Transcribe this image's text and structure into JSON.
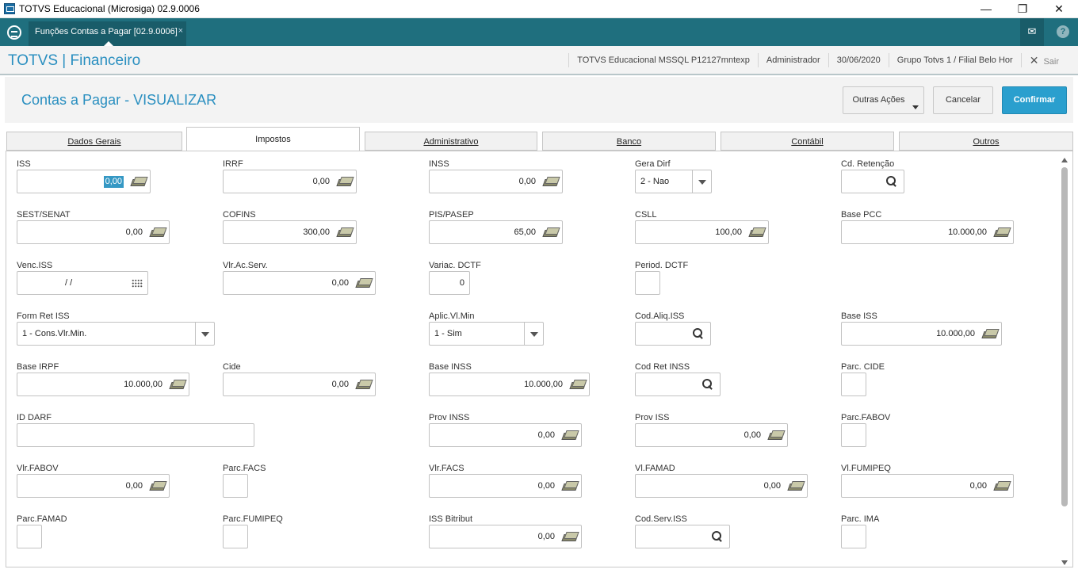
{
  "window": {
    "title": "TOTVS Educacional (Microsiga) 02.9.0006",
    "minimize": "—",
    "maximize": "❐",
    "close": "✕"
  },
  "appbar": {
    "tab_label": "Funções Contas a Pagar [02.9.0006]",
    "tab_close": "×",
    "mail_icon": "✉",
    "help_icon": "?"
  },
  "module": {
    "title": "TOTVS | Financeiro",
    "environment": "TOTVS Educacional MSSQL P12127mntexp",
    "user": "Administrador",
    "date": "30/06/2020",
    "branch": "Grupo Totvs 1 / Filial Belo Hor",
    "exit_icon": "✕",
    "exit_label": "Sair"
  },
  "page": {
    "title": "Contas a Pagar - VISUALIZAR",
    "buttons": {
      "more": "Outras Ações",
      "cancel": "Cancelar",
      "confirm": "Confirmar"
    }
  },
  "tabs": [
    {
      "label": "Dados Gerais"
    },
    {
      "label": "Impostos"
    },
    {
      "label": "Administrativo"
    },
    {
      "label": "Banco"
    },
    {
      "label": "Contábil"
    },
    {
      "label": "Outros"
    }
  ],
  "fields": {
    "iss": {
      "label": "ISS",
      "value": "0,00"
    },
    "irrf": {
      "label": "IRRF",
      "value": "0,00"
    },
    "inss": {
      "label": "INSS",
      "value": "0,00"
    },
    "gera_dirf": {
      "label": "Gera Dirf",
      "value": "2 - Nao"
    },
    "cd_retencao": {
      "label": "Cd. Retenção",
      "value": ""
    },
    "sest_senat": {
      "label": "SEST/SENAT",
      "value": "0,00"
    },
    "cofins": {
      "label": "COFINS",
      "value": "300,00"
    },
    "pis_pasep": {
      "label": "PIS/PASEP",
      "value": "65,00"
    },
    "csll": {
      "label": "CSLL",
      "value": "100,00"
    },
    "base_pcc": {
      "label": "Base PCC",
      "value": "10.000,00"
    },
    "venc_iss": {
      "label": "Venc.ISS",
      "value": "/  /"
    },
    "vlr_ac_serv": {
      "label": "Vlr.Ac.Serv.",
      "value": "0,00"
    },
    "variac_dctf": {
      "label": "Variac. DCTF",
      "value": "0"
    },
    "period_dctf": {
      "label": "Period. DCTF",
      "value": ""
    },
    "form_ret_iss": {
      "label": "Form Ret ISS",
      "value": "1 - Cons.Vlr.Min."
    },
    "aplic_vl_min": {
      "label": "Aplic.Vl.Min",
      "value": "1 - Sim"
    },
    "cod_aliq_iss": {
      "label": "Cod.Aliq.ISS",
      "value": ""
    },
    "base_iss": {
      "label": "Base ISS",
      "value": "10.000,00"
    },
    "base_irpf": {
      "label": "Base IRPF",
      "value": "10.000,00"
    },
    "cide": {
      "label": "Cide",
      "value": "0,00"
    },
    "base_inss": {
      "label": "Base INSS",
      "value": "10.000,00"
    },
    "cod_ret_inss": {
      "label": "Cod Ret INSS",
      "value": ""
    },
    "parc_cide": {
      "label": "Parc. CIDE",
      "value": ""
    },
    "id_darf": {
      "label": "ID DARF",
      "value": ""
    },
    "prov_inss": {
      "label": "Prov INSS",
      "value": "0,00"
    },
    "prov_iss": {
      "label": "Prov ISS",
      "value": "0,00"
    },
    "parc_fabov": {
      "label": "Parc.FABOV",
      "value": ""
    },
    "vlr_fabov": {
      "label": "Vlr.FABOV",
      "value": "0,00"
    },
    "parc_facs": {
      "label": "Parc.FACS",
      "value": ""
    },
    "vlr_facs": {
      "label": "Vlr.FACS",
      "value": "0,00"
    },
    "vl_famad": {
      "label": "Vl.FAMAD",
      "value": "0,00"
    },
    "vl_fumipeq": {
      "label": "Vl.FUMIPEQ",
      "value": "0,00"
    },
    "parc_famad": {
      "label": "Parc.FAMAD",
      "value": ""
    },
    "parc_fumipeq": {
      "label": "Parc.FUMIPEQ",
      "value": ""
    },
    "iss_bitribut": {
      "label": "ISS Bitribut",
      "value": "0,00"
    },
    "cod_serv_iss": {
      "label": "Cod.Serv.ISS",
      "value": ""
    },
    "parc_ima": {
      "label": "Parc. IMA",
      "value": ""
    }
  },
  "colors": {
    "appbar": "#1f6f7e",
    "accent": "#2a8fc0",
    "primary_button": "#2a9fce"
  }
}
